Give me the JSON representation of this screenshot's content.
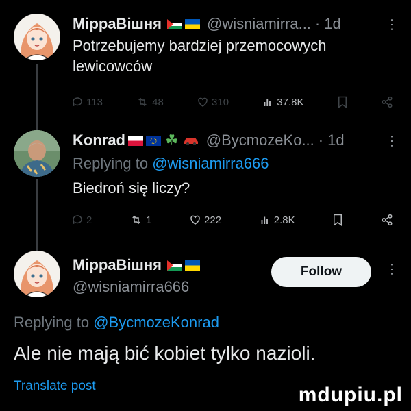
{
  "tweet1": {
    "name": "МірраВішня",
    "handle": "@wisniamirra...",
    "time": "1d",
    "text_line1": "Potrzebujemy bardziej przemocowych",
    "text_line2": "lewicowców",
    "replies": "113",
    "reposts": "48",
    "likes": "310",
    "views": "37.8K"
  },
  "tweet2": {
    "name": "Konrad",
    "name_emoji": "☘",
    "handle": "@BycmozeKo...",
    "time": "1d",
    "replying_label": "Replying to",
    "replying_handle": "@wisniamirra666",
    "text": "Biedroń się liczy?",
    "replies": "2",
    "reposts": "1",
    "likes": "222",
    "views": "2.8K"
  },
  "tweet3": {
    "name": "МірраВішня",
    "handle": "@wisniamirra666",
    "follow_label": "Follow",
    "replying_label": "Replying to",
    "replying_handle": "@BycmozeKonrad",
    "text": "Ale nie mają bić kobiet tylko nazioli.",
    "translate_label": "Translate post"
  },
  "watermark": "mdupiu.pl",
  "colors": {
    "background": "#000000",
    "link": "#1d9bf0",
    "follow_button": "#eff3f4"
  }
}
